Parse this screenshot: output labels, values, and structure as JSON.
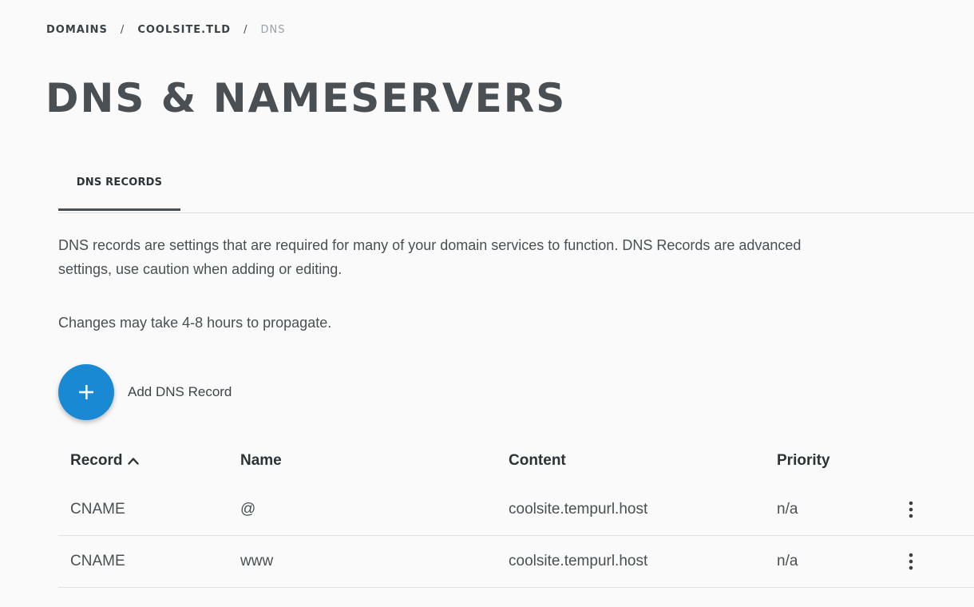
{
  "breadcrumb": {
    "items": [
      "DOMAINS",
      "COOLSITE.TLD"
    ],
    "separator": "/",
    "current": "DNS"
  },
  "page": {
    "title": "DNS & NAMESERVERS"
  },
  "tabs": [
    {
      "label": "DNS RECORDS",
      "active": true
    }
  ],
  "description": "DNS records are settings that are required for many of your domain services to function. DNS Records are advanced settings, use caution when adding or editing.",
  "propagation_note": "Changes may take 4-8 hours to propagate.",
  "add_record": {
    "label": "Add DNS Record",
    "icon": "plus-icon",
    "color": "#1a89d3"
  },
  "table": {
    "columns": {
      "record": "Record",
      "name": "Name",
      "content": "Content",
      "priority": "Priority"
    },
    "sort": {
      "column": "record",
      "direction": "ascending",
      "icon": "chevron-up-icon"
    },
    "rows": [
      {
        "record": "CNAME",
        "name": "@",
        "content": "coolsite.tempurl.host",
        "priority": "n/a"
      },
      {
        "record": "CNAME",
        "name": "www",
        "content": "coolsite.tempurl.host",
        "priority": "n/a"
      }
    ],
    "row_menu_icon": "more-vertical-icon"
  }
}
